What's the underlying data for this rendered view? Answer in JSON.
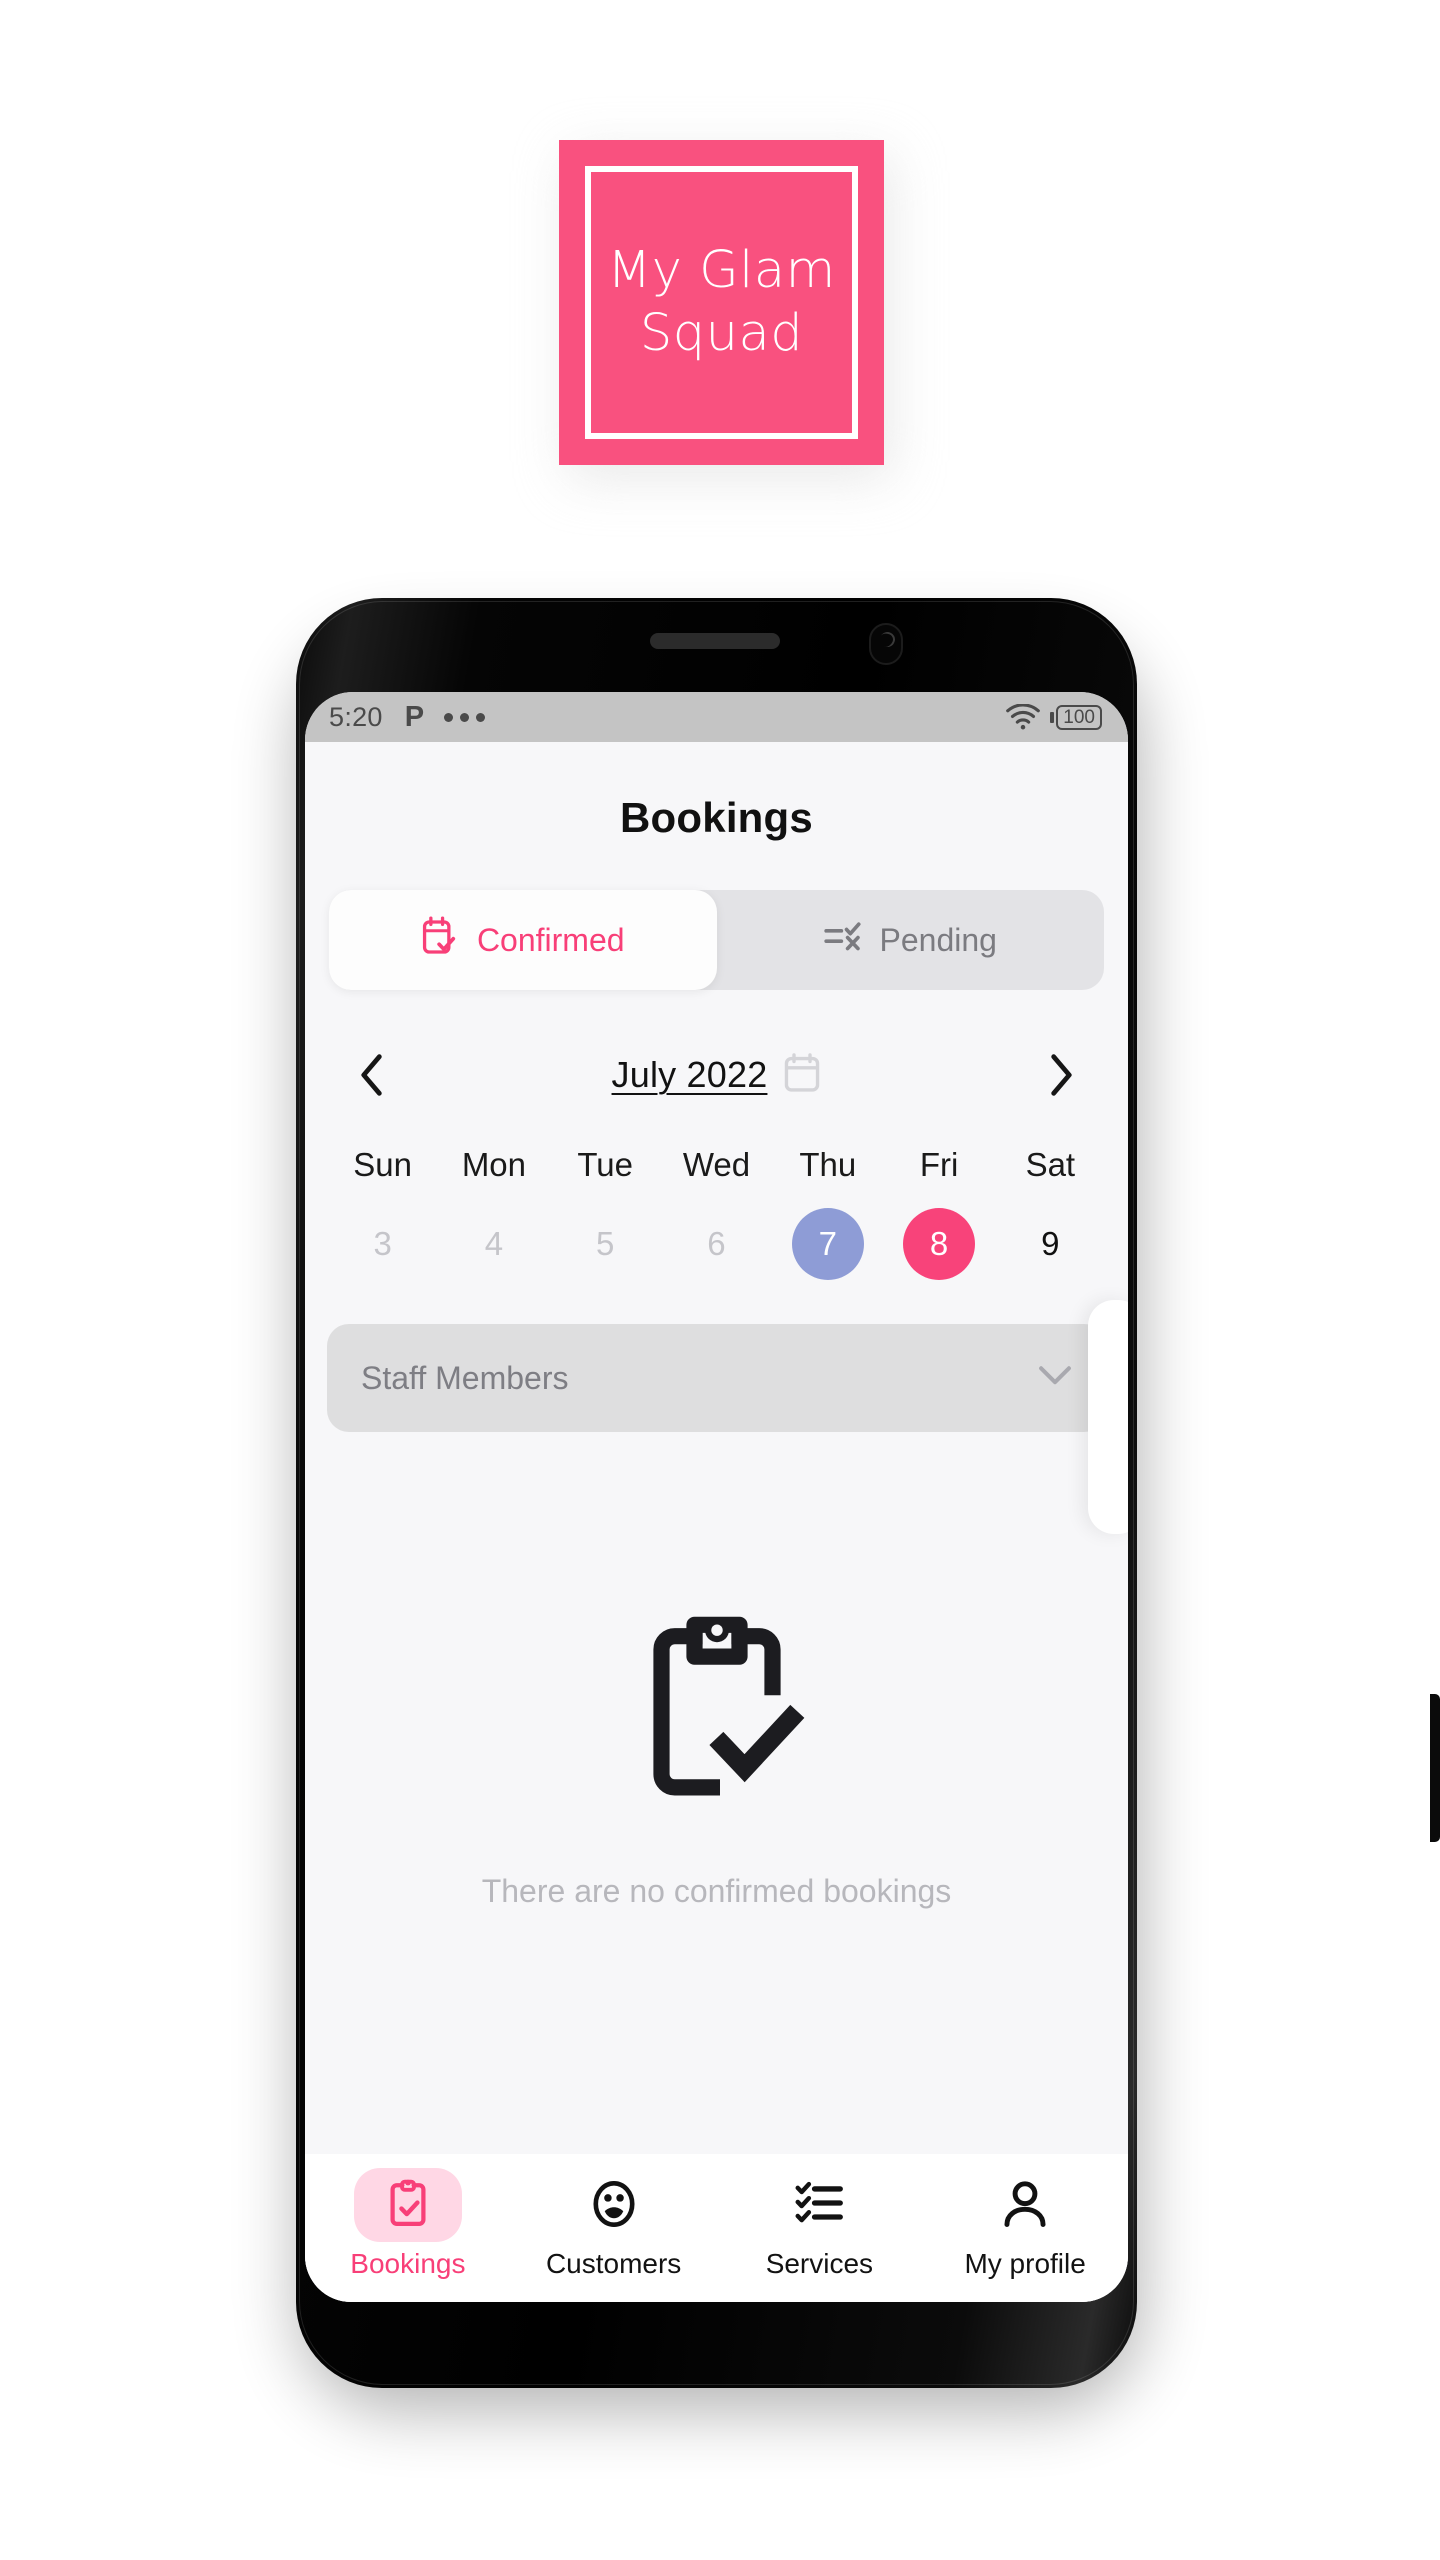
{
  "logo": {
    "name": "logo-badge",
    "line1": "My Glam",
    "line2": "Squad",
    "text": "My Glam\nSquad",
    "bg_color": "#f9517f",
    "border_color": "#ffffff"
  },
  "statusbar": {
    "time": "5:20",
    "carrier_glyph": "P",
    "overflow_icon": "more-dots-icon",
    "wifi_icon": "wifi-icon",
    "battery_icon": "battery-icon",
    "battery_level": "100"
  },
  "header": {
    "title": "Bookings"
  },
  "segment": {
    "options": [
      {
        "label": "Confirmed",
        "icon": "calendar-check-icon",
        "active": true
      },
      {
        "label": "Pending",
        "icon": "list-check-x-icon",
        "active": false
      }
    ],
    "active_color": "#f83f78",
    "inactive_color": "#7b7b80"
  },
  "calendar": {
    "prev_icon": "chevron-left-icon",
    "next_icon": "chevron-right-icon",
    "month_label": "July 2022",
    "picker_icon": "calendar-icon",
    "weekdays": [
      "Sun",
      "Mon",
      "Tue",
      "Wed",
      "Thu",
      "Fri",
      "Sat"
    ],
    "days": [
      {
        "num": "3",
        "state": "past"
      },
      {
        "num": "4",
        "state": "past"
      },
      {
        "num": "5",
        "state": "past"
      },
      {
        "num": "6",
        "state": "past"
      },
      {
        "num": "7",
        "state": "today"
      },
      {
        "num": "8",
        "state": "selected"
      },
      {
        "num": "9",
        "state": "plain"
      }
    ],
    "today_color": "#8e9cd6",
    "selected_color": "#f8437a"
  },
  "staff_filter": {
    "placeholder": "Staff Members",
    "value": "Staff Members",
    "chevron_icon": "chevron-down-icon"
  },
  "empty_state": {
    "icon": "clipboard-check-icon",
    "message": "There are no confirmed bookings"
  },
  "bottom_nav": {
    "items": [
      {
        "label": "Bookings",
        "icon": "clipboard-check-icon",
        "active": true
      },
      {
        "label": "Customers",
        "icon": "customers-face-icon",
        "active": false
      },
      {
        "label": "Services",
        "icon": "checklist-icon",
        "active": false
      },
      {
        "label": "My profile",
        "icon": "person-icon",
        "active": false
      }
    ],
    "active_color": "#f83f78",
    "active_pill_color": "#ffd7e5"
  }
}
